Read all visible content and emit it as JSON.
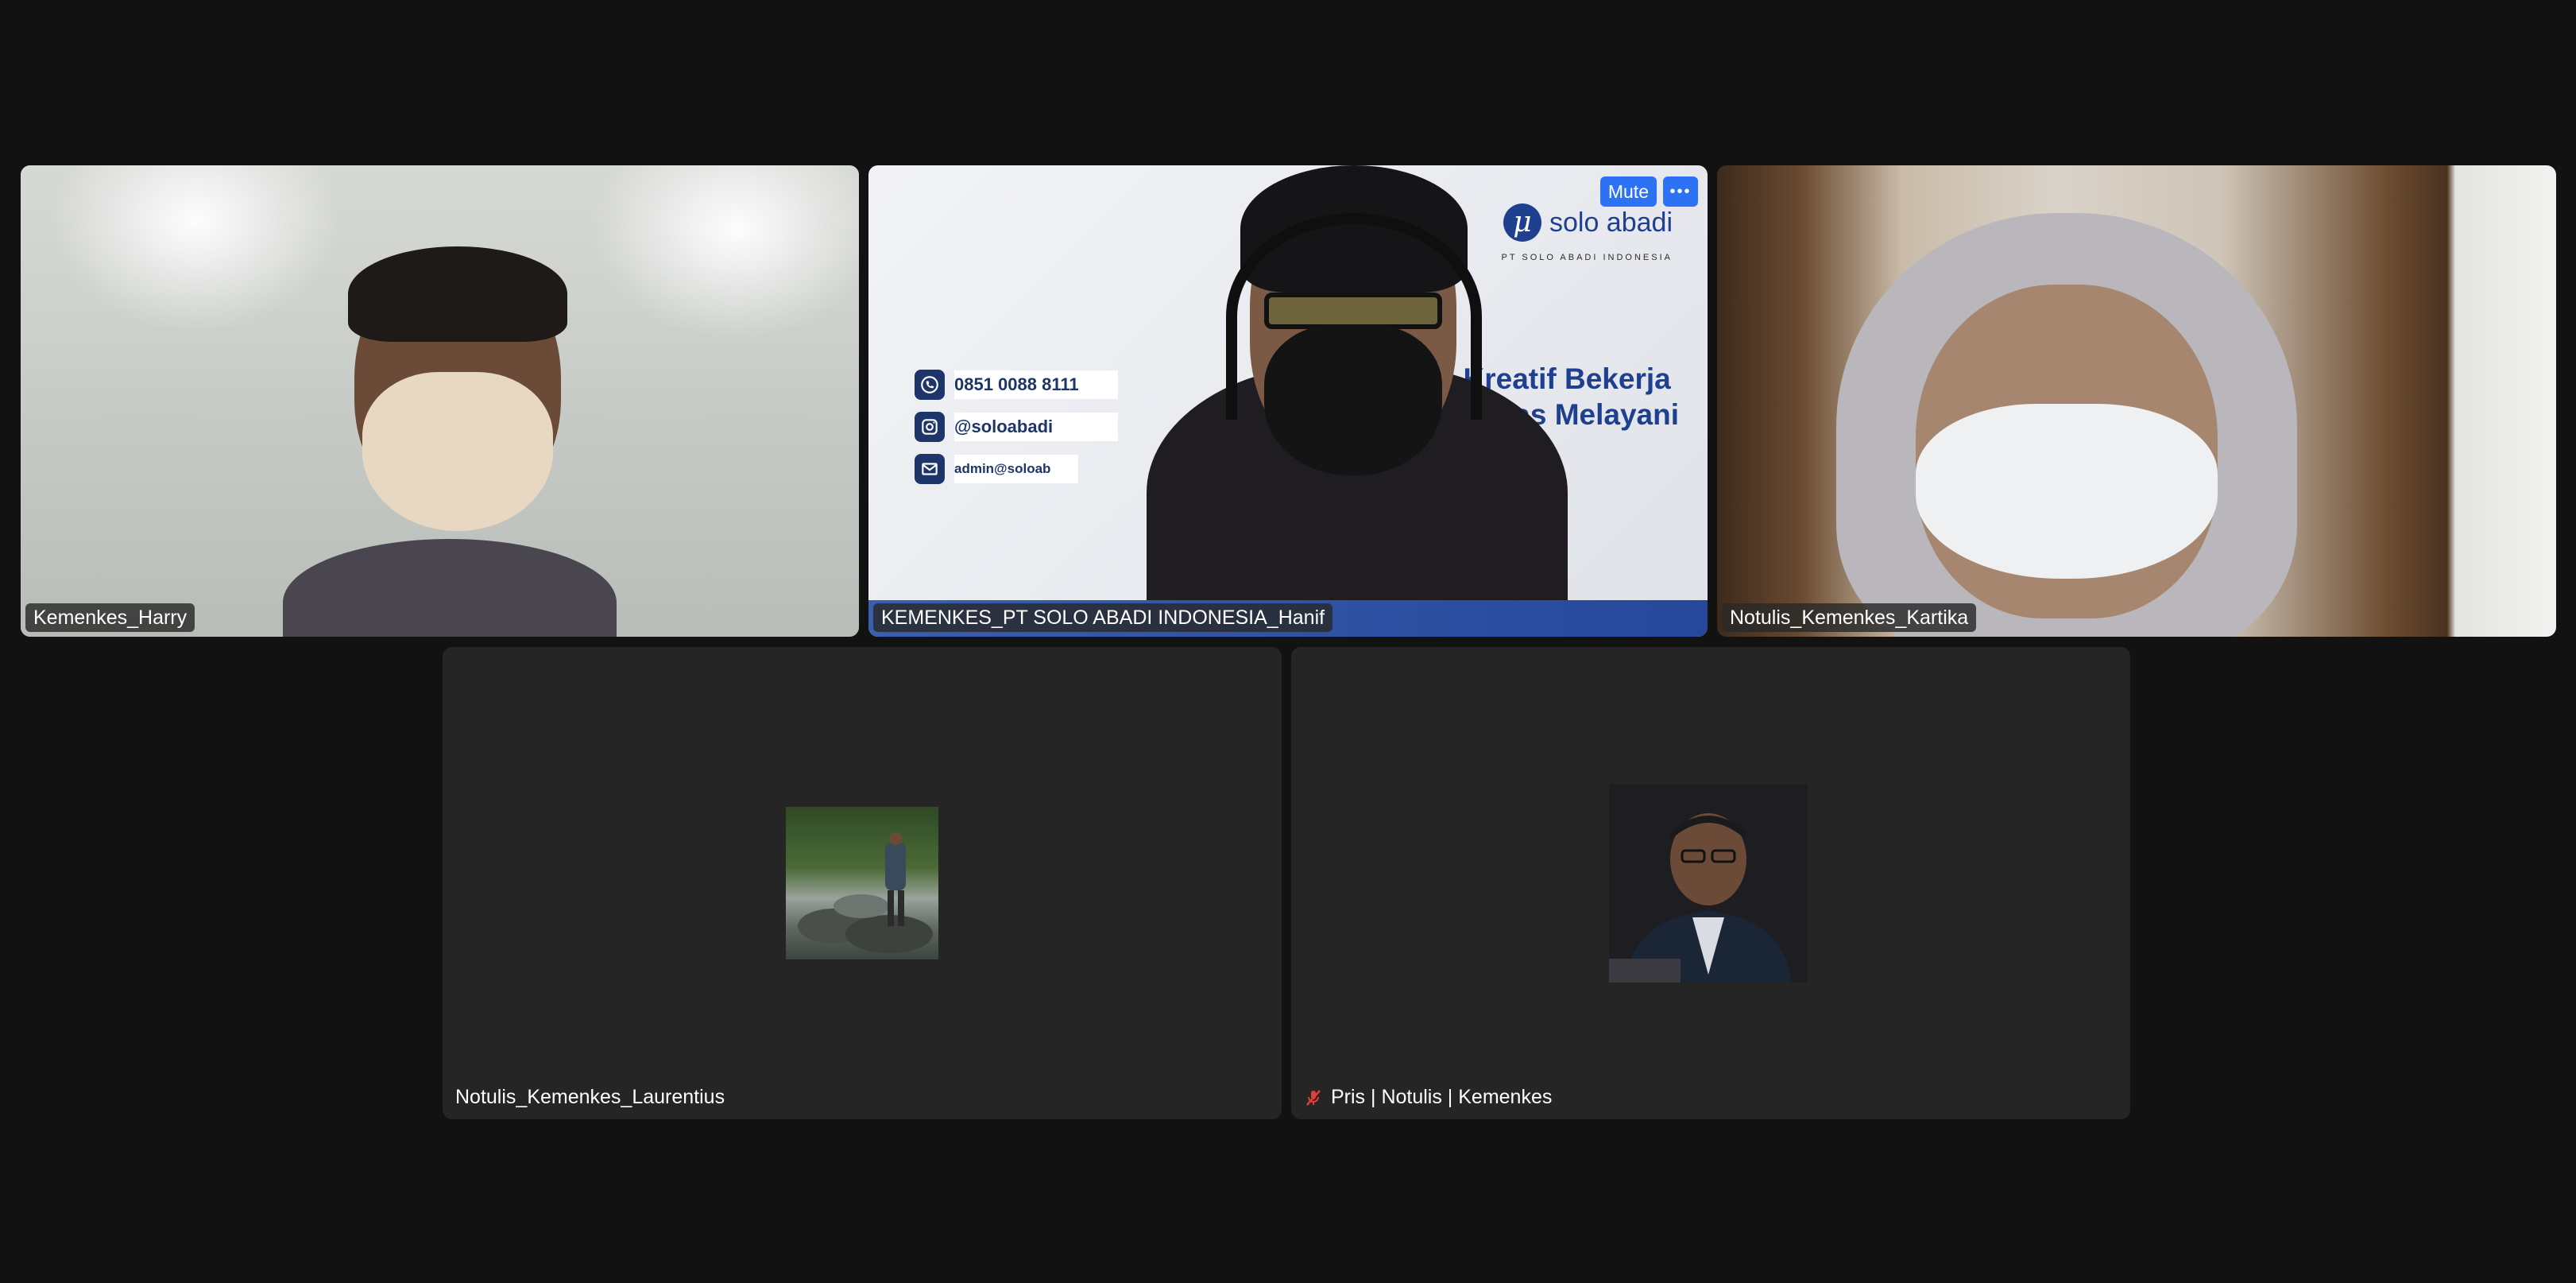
{
  "participants": [
    {
      "name": "Kemenkes_Harry",
      "active_speaker": true
    },
    {
      "name": "KEMENKES_PT SOLO ABADI INDONESIA_Hanif"
    },
    {
      "name": "Notulis_Kemenkes_Kartika"
    },
    {
      "name": "Notulis_Kemenkes_Laurentius"
    },
    {
      "name": "Pris | Notulis | Kemenkes",
      "muted": true
    }
  ],
  "tile_controls": {
    "mute_label": "Mute",
    "more_icon": "ellipsis-icon"
  },
  "virtual_background": {
    "logo_text": "solo abadi",
    "logo_subtitle": "PT SOLO ABADI INDONESIA",
    "slogan_line1": "Kreatif Bekerja",
    "slogan_line2": "Ikhlas Melayani",
    "phone": "0851 0088 8111",
    "instagram": "@soloabadi",
    "email": "admin@soloab"
  },
  "colors": {
    "background": "#121212",
    "tile": "#252525",
    "active_speaker_border": "#7be06a",
    "button_blue": "#2d72f4",
    "brand_blue": "#1f3f8f",
    "muted_red": "#e0403a"
  }
}
